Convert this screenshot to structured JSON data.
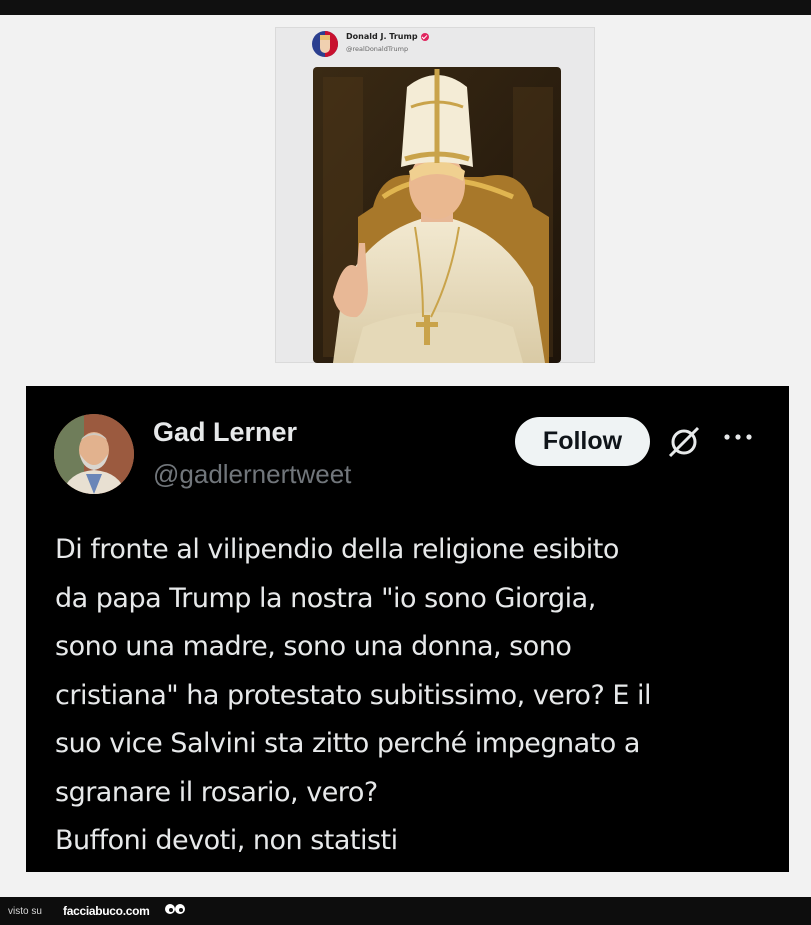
{
  "embedded_post": {
    "author_name": "Donald J. Trump",
    "author_handle": "@realDonaldTrump",
    "icons": [
      "verified-badge-icon",
      "avatar-flag-icon"
    ]
  },
  "tweet": {
    "author_name": "Gad Lerner",
    "author_handle": "@gadlernertweet",
    "follow_label": "Follow",
    "text": "Di fronte al vilipendio della religione esibito\nda papa Trump la nostra \"io sono Giorgia,\nsono una madre, sono una donna, sono\ncristiana\" ha protestato subitissimo, vero? E il\nsuo vice Salvini sta zitto perché impegnato a\nsgranare il rosario, vero?\nBuffoni devoti, non statisti",
    "icons": [
      "grok-icon",
      "more-icon"
    ]
  },
  "footer": {
    "visto_label": "visto su",
    "brand": "facciabuco.com"
  },
  "colors": {
    "card_bg": "#000000",
    "text_primary": "#e7e9ea",
    "text_secondary": "#71767b",
    "follow_bg": "#eff3f4"
  }
}
